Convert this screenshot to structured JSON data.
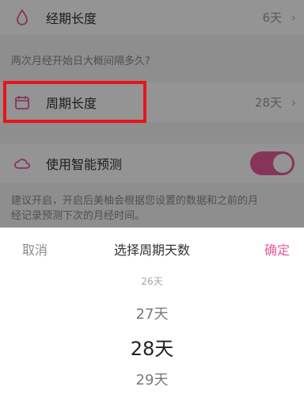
{
  "settings": {
    "period_length": {
      "label": "经期长度",
      "value": "6天",
      "icon": "drop-icon"
    },
    "section_question": "两次月经开始日大概间隔多久?",
    "cycle_length": {
      "label": "周期长度",
      "value": "28天",
      "icon": "calendar-icon"
    },
    "smart_prediction": {
      "label": "使用智能预测",
      "icon": "cloud-icon",
      "enabled": true
    },
    "prediction_note_line1": "建议开启，开启后美柚会根据您设置的数据和之前的月",
    "prediction_note_line2": "经记录预测下次的月经时间。"
  },
  "picker": {
    "cancel": "取消",
    "title": "选择周期天数",
    "confirm": "确定",
    "options": [
      "26天",
      "27天",
      "28天",
      "29天"
    ],
    "selected": "28天"
  },
  "colors": {
    "accent": "#e85a9c",
    "highlight": "#e8141a"
  }
}
